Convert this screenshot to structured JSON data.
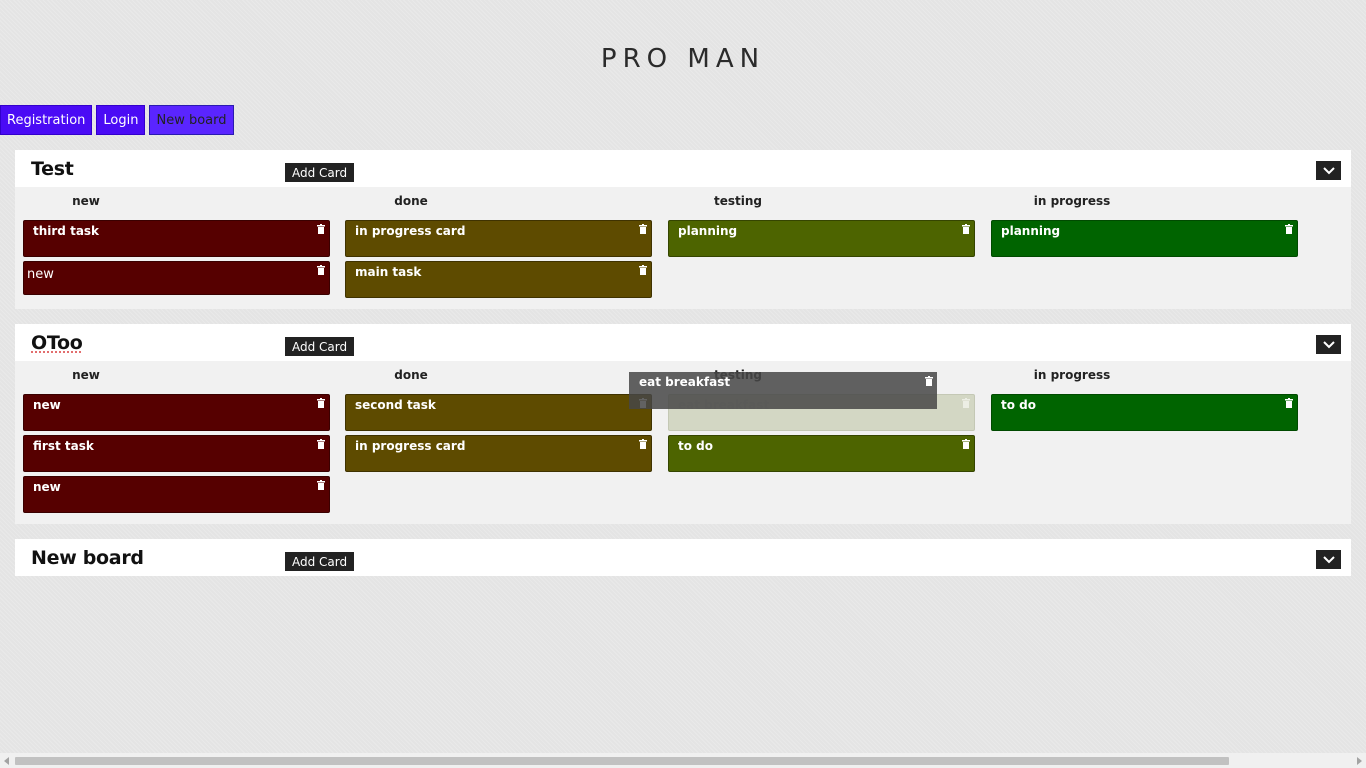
{
  "app_title": "PRO MAN",
  "nav": {
    "registration": "Registration",
    "login": "Login",
    "new_board": "New board"
  },
  "common": {
    "add_card": "Add Card"
  },
  "icons": {
    "toggle": "chevron-down-icon",
    "delete": "trash-icon"
  },
  "colors": {
    "new": "#560000",
    "done": "#5e4b00",
    "testing": "#4d6400",
    "in_progress": "#006400",
    "nav_button": "#4a0bf5"
  },
  "boards": [
    {
      "title": "Test",
      "columns": [
        "new",
        "done",
        "testing",
        "in progress"
      ],
      "cards": {
        "new": [
          "third task",
          "new"
        ],
        "done": [
          "in progress card",
          "main task"
        ],
        "testing": [
          "planning"
        ],
        "in_progress": [
          "planning"
        ]
      }
    },
    {
      "title": "OToo",
      "columns": [
        "new",
        "done",
        "testing",
        "in progress"
      ],
      "cards": {
        "new": [
          "new",
          "first task",
          "new"
        ],
        "done": [
          "second task",
          "in progress card"
        ],
        "testing": [
          "eat breakfast",
          "to do"
        ],
        "in_progress": [
          "to do"
        ]
      },
      "dragging_card": "eat breakfast"
    },
    {
      "title": "New board",
      "collapsed": true
    }
  ]
}
